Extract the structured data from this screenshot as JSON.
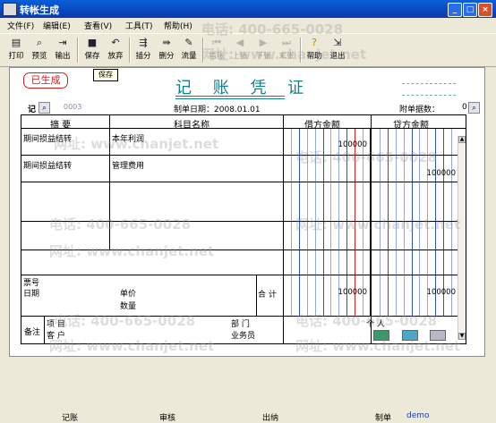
{
  "window": {
    "title": "转帐生成"
  },
  "menu": [
    "文件(F)",
    "编辑(E)",
    "查看(V)",
    "工具(T)",
    "帮助(H)"
  ],
  "toolbar": {
    "print": "打印",
    "preview": "预览",
    "output": "输出",
    "save": "保存",
    "discard": "放弃",
    "insert": "插分",
    "delete": "删分",
    "flow": "流量",
    "first": "首张",
    "prev": "上张",
    "next": "下张",
    "last": "末张",
    "help": "帮助",
    "exit": "退出"
  },
  "tooltip": "保存",
  "voucher": {
    "stamp": "已生成",
    "title": "记 账 凭 证",
    "type_label": "记",
    "number": "0003",
    "date_label": "制单日期：",
    "date": "2008.01.01",
    "attachments_label": "附单据数：",
    "attachments": "0"
  },
  "table": {
    "headers": {
      "summary": "摘  要",
      "account": "科目名称",
      "debit": "借方金额",
      "credit": "贷方金额"
    },
    "rows": [
      {
        "summary": "期间损益结转",
        "account": "本年利润",
        "debit": "100000",
        "credit": ""
      },
      {
        "summary": "期间损益结转",
        "account": "管理费用",
        "debit": "",
        "credit": "100000"
      },
      {
        "summary": "",
        "account": "",
        "debit": "",
        "credit": ""
      },
      {
        "summary": "",
        "account": "",
        "debit": "",
        "credit": ""
      },
      {
        "summary": "",
        "account": "",
        "debit": "",
        "credit": ""
      }
    ],
    "bill_no_label": "票号",
    "date_label": "日期",
    "price_label": "单价",
    "qty_label": "数量",
    "total_label": "合 计",
    "total_debit": "100000",
    "total_credit": "100000"
  },
  "remarks": {
    "label": "备注",
    "project": "项    目",
    "customer": "客    户",
    "department": "部    门",
    "salesperson": "业务员",
    "person": "个    人"
  },
  "footer": {
    "bookkeeper": "记账",
    "reviewer": "审核",
    "cashier": "出纳",
    "preparer": "制单",
    "preparer_name": "demo"
  },
  "watermark": {
    "phone": "电话: 400-665-0028",
    "url": "网址: www.chanjet.net"
  },
  "colors": {
    "title": "#10808a",
    "stamp": "#d02020",
    "titlebar": "#0a47c0"
  }
}
